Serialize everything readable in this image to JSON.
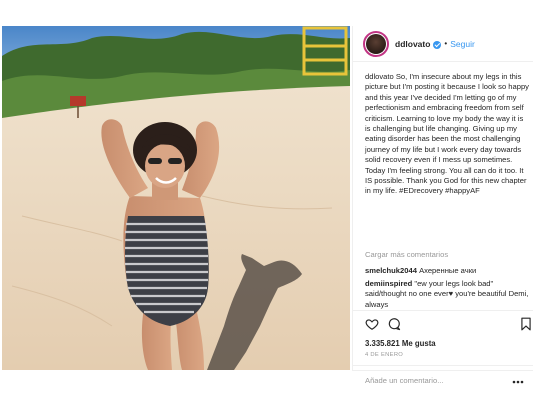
{
  "header": {
    "username": "ddlovato",
    "separator": "•",
    "follow_label": "Seguir"
  },
  "caption": {
    "username": "ddlovato",
    "text": "So, I'm insecure about my legs in this picture but I'm posting it because I look so happy and this year I've decided I'm letting go of my perfectionism and embracing freedom from self criticism. Learning to love my body the way it is is challenging but life changing. Giving up my eating disorder has been the most challenging journey of my life but I work every day towards solid recovery even if I mess up sometimes. Today I'm feeling strong. You all can do it too. It IS possible. Thank you God for this new chapter in my life. #EDrecovery #happyAF"
  },
  "more_comments_label": "Cargar más comentarios",
  "comments": [
    {
      "username": "smelchuk2044",
      "text": "Ахеренные ачки"
    },
    {
      "username": "demiinspired",
      "text": "\"ew your legs look bad\" said/thought no one ever♥ you're beautiful Demi, always"
    }
  ],
  "likes_text": "3.335.821 Me gusta",
  "date_text": "4 DE ENERO",
  "add_comment_placeholder": "Añade un comentario...",
  "colors": {
    "accent": "#3897f0",
    "text": "#262626",
    "muted": "#999999",
    "border": "#efefef"
  }
}
